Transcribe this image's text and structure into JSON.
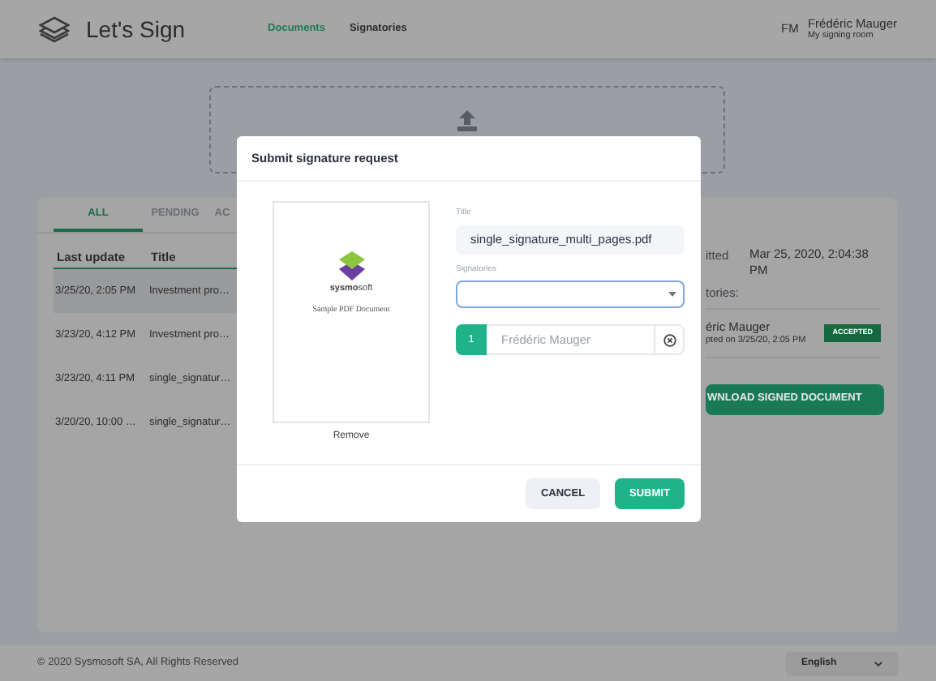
{
  "header": {
    "app_name": "Let's Sign",
    "nav": [
      {
        "label": "Documents",
        "selected": true
      },
      {
        "label": "Signatories",
        "selected": false
      }
    ],
    "user": {
      "initials": "FM",
      "name": "Frédéric Mauger",
      "subtitle": "My signing room"
    }
  },
  "documents": {
    "tabs": [
      {
        "label": "ALL",
        "selected": true
      },
      {
        "label": "PENDING",
        "selected": false
      },
      {
        "label": "AC",
        "selected": false
      }
    ],
    "columns": [
      "Last update",
      "Title"
    ],
    "rows": [
      {
        "last_update": "3/25/20, 2:05 PM",
        "title": "Investment pro…",
        "selected": true
      },
      {
        "last_update": "3/23/20, 4:12 PM",
        "title": "Investment pro…",
        "selected": false
      },
      {
        "last_update": "3/23/20, 4:11 PM",
        "title": "single_signatur…",
        "selected": false
      },
      {
        "last_update": "3/20/20, 10:00 …",
        "title": "single_signatur…",
        "selected": false
      }
    ]
  },
  "details": {
    "submitted_label": "itted",
    "submitted_value": "Mar 25, 2020, 2:04:38 PM",
    "signatories_label": "tories:",
    "signer_name": "éric Mauger",
    "signer_note": "pted on 3/25/20, 2:05 PM",
    "signer_status": "ACCEPTED",
    "download_button": "WNLOAD SIGNED DOCUMENT"
  },
  "footer": {
    "copyright": "© 2020 Sysmosoft SA, All Rights Reserved",
    "language": "English"
  },
  "dialog": {
    "title": "Submit signature request",
    "preview": {
      "brand": "**sysmo**soft",
      "caption": "Sample PDF Document"
    },
    "remove_link": "Remove",
    "title_label": "Title",
    "title_value": "single_signature_multi_pages.pdf",
    "signatories_label": "Signatories",
    "signatories": [
      {
        "number": "1",
        "placeholder": "Frédéric Mauger"
      }
    ],
    "buttons": [
      {
        "kind": "secondary",
        "label": "CANCEL"
      },
      {
        "kind": "primary",
        "label": "SUBMIT"
      }
    ]
  }
}
